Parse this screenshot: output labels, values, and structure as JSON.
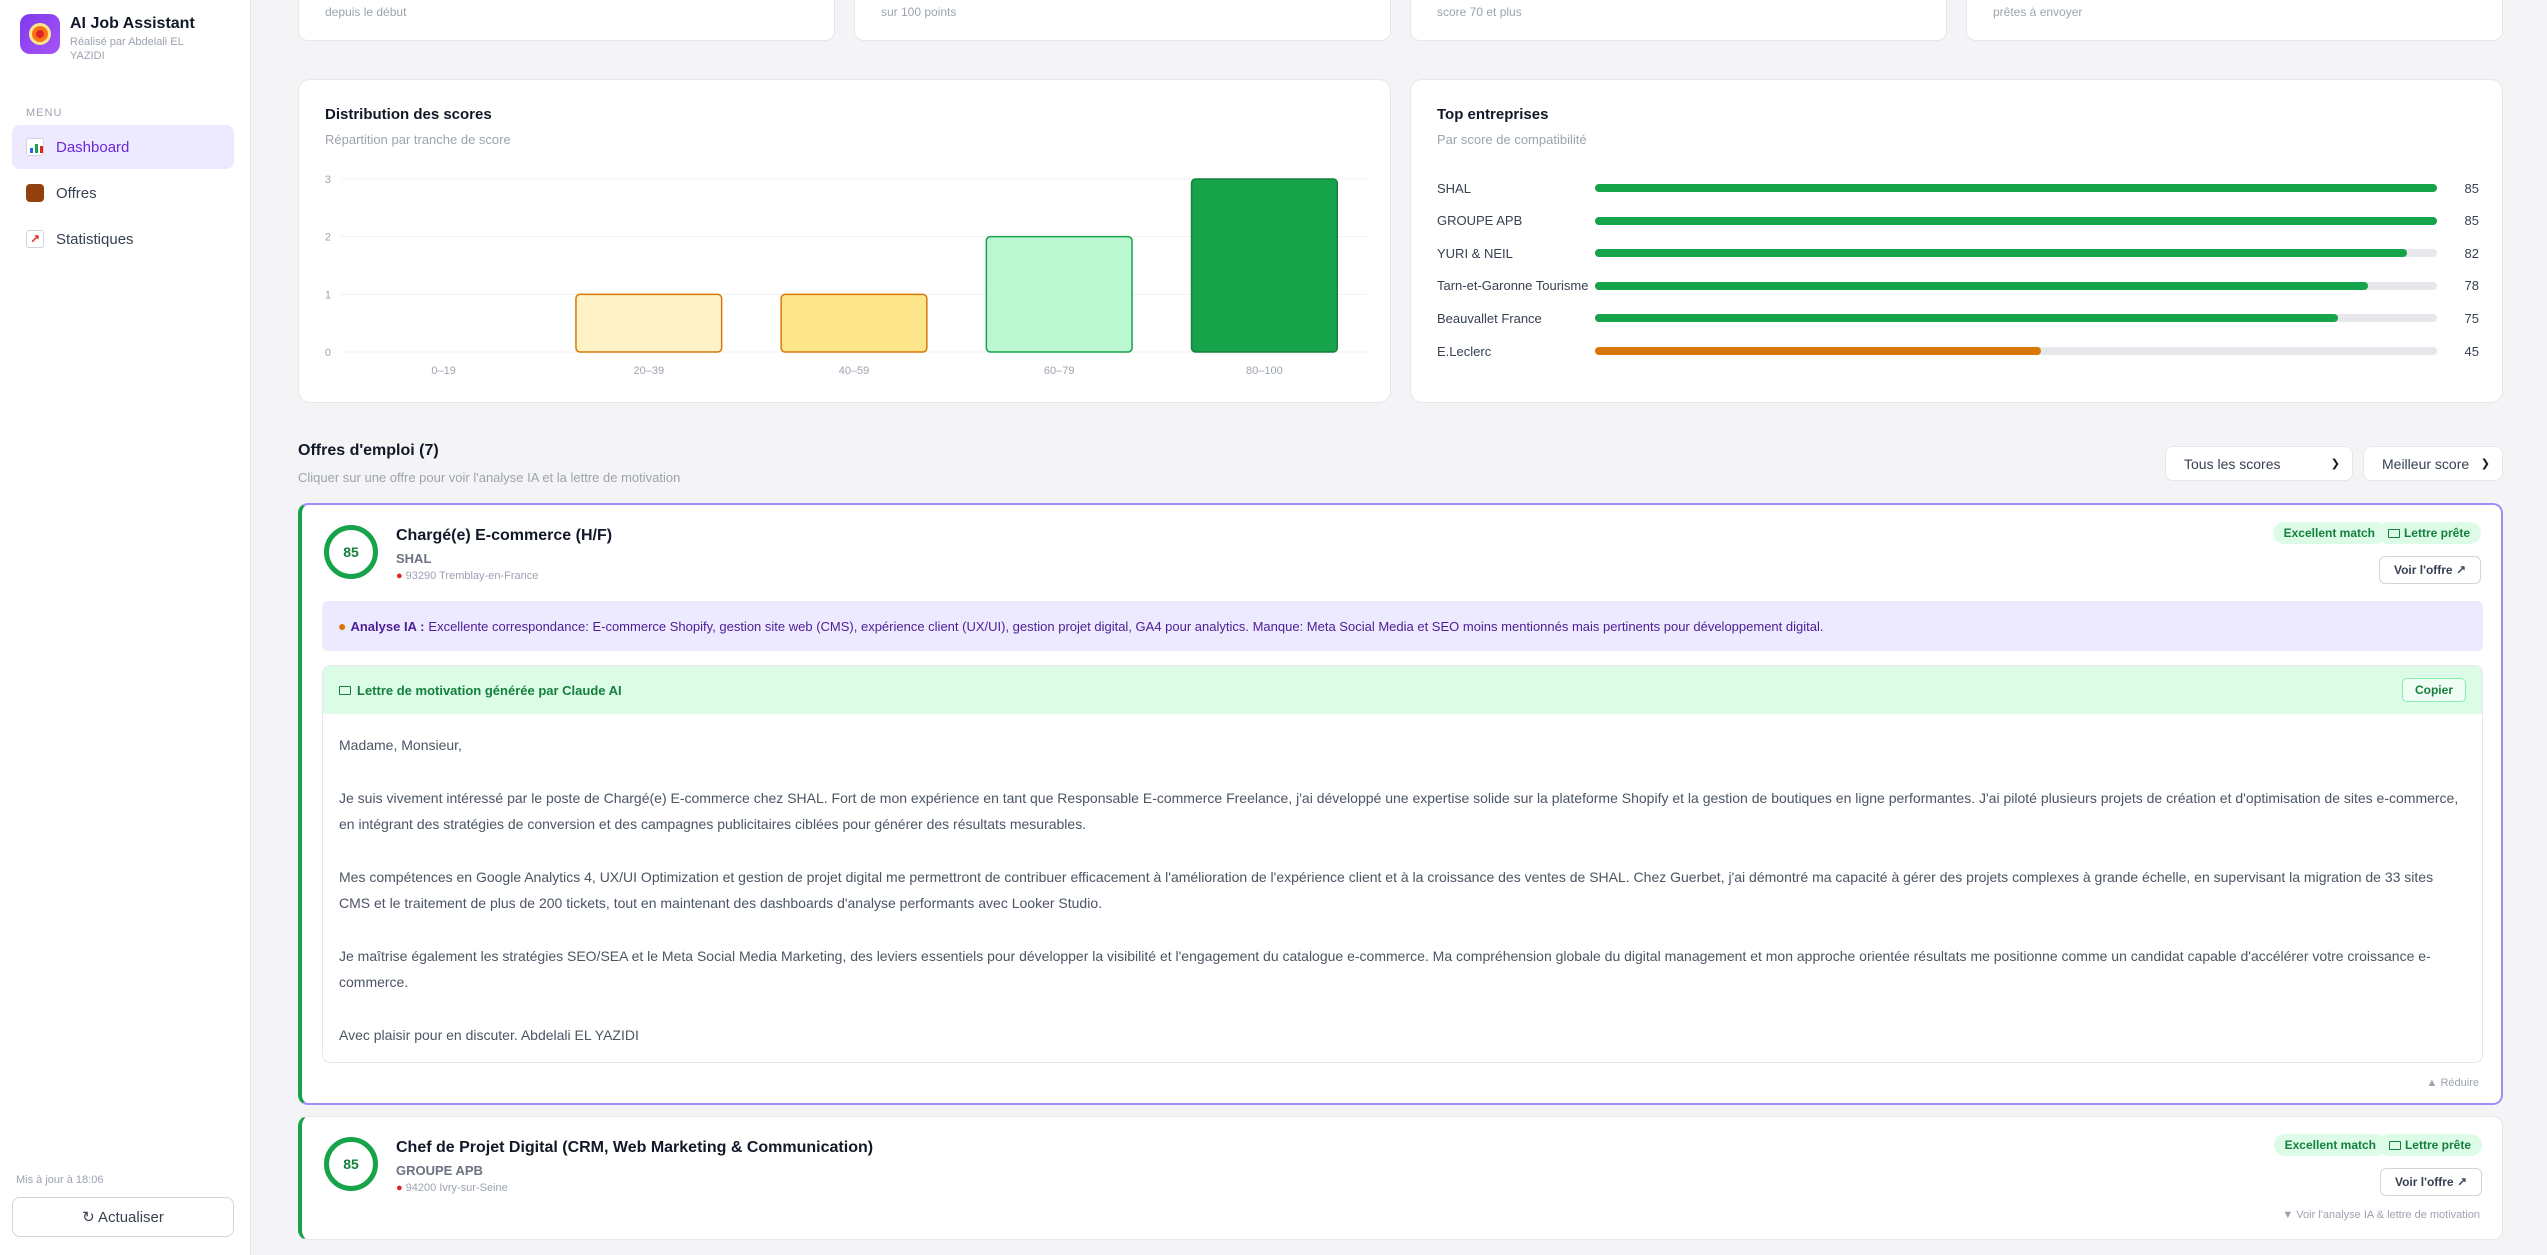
{
  "app": {
    "title": "AI Job Assistant",
    "subtitle": "Réalisé par Abdelali EL YAZIDI"
  },
  "sidebar": {
    "menu_label": "MENU",
    "items": [
      {
        "label": "Dashboard",
        "icon": "bar-chart-icon",
        "active": true
      },
      {
        "label": "Offres",
        "icon": "briefcase-icon",
        "active": false
      },
      {
        "label": "Statistiques",
        "icon": "trend-chart-icon",
        "active": false
      }
    ],
    "updated": "Mis à jour à 18:06",
    "refresh_label": "↻ Actualiser"
  },
  "stats": [
    {
      "caption": "depuis le début"
    },
    {
      "caption": "sur 100 points"
    },
    {
      "caption": "score 70 et plus"
    },
    {
      "caption": "prêtes à envoyer"
    }
  ],
  "distribution": {
    "title": "Distribution des scores",
    "subtitle": "Répartition par tranche de score",
    "chart_data": {
      "type": "bar",
      "categories": [
        "0–19",
        "20–39",
        "40–59",
        "60–79",
        "80–100"
      ],
      "values": [
        0,
        1,
        1,
        2,
        3
      ],
      "ylim": [
        0,
        3
      ],
      "yticks": [
        "0",
        "1",
        "2",
        "3"
      ],
      "bar_fill": [
        "#fef3c7",
        "#fef3c7",
        "#fde68a",
        "#bbf7d0",
        "#16a34a"
      ],
      "bar_stroke": [
        "#d97706",
        "#d97706",
        "#d97706",
        "#16a34a",
        "#15803d"
      ],
      "grid": true
    }
  },
  "top_companies": {
    "title": "Top entreprises",
    "subtitle": "Par score de compatibilité",
    "chart_data": {
      "type": "bar",
      "orientation": "horizontal",
      "categories": [
        "SHAL",
        "GROUPE APB",
        "YURI & NEIL",
        "Tarn-et-Garonne Tourisme",
        "Beauvallet France",
        "E.Leclerc"
      ],
      "values": [
        85,
        85,
        82,
        78,
        75,
        45
      ],
      "xlim": [
        0,
        85
      ],
      "colors": [
        "#16a34a",
        "#16a34a",
        "#16a34a",
        "#16a34a",
        "#16a34a",
        "#d97706"
      ]
    }
  },
  "offers_section": {
    "title": "Offres d'emploi (7)",
    "subtitle": "Cliquer sur une offre pour voir l'analyse IA et la lettre de motivation",
    "filter_score": "Tous les scores",
    "sort": "Meilleur score"
  },
  "offers": [
    {
      "score": "85",
      "title": "Chargé(e) E-commerce (H/F)",
      "company": "SHAL",
      "location": "93290 Tremblay-en-France",
      "badge_match": "Excellent match",
      "badge_letter": "Lettre prête",
      "view_label": "Voir l'offre ↗",
      "analysis_label": "Analyse IA :",
      "analysis_text": "Excellente correspondance: E-commerce Shopify, gestion site web (CMS), expérience client (UX/UI), gestion projet digital, GA4 pour analytics. Manque: Meta Social Media et SEO moins mentionnés mais pertinents pour développement digital.",
      "letter_title": "Lettre de motivation générée par Claude AI",
      "copy_label": "Copier",
      "letter": [
        "Madame, Monsieur,",
        "Je suis vivement intéressé par le poste de Chargé(e) E-commerce chez SHAL. Fort de mon expérience en tant que Responsable E-commerce Freelance, j'ai développé une expertise solide sur la plateforme Shopify et la gestion de boutiques en ligne performantes. J'ai piloté plusieurs projets de création et d'optimisation de sites e-commerce, en intégrant des stratégies de conversion et des campagnes publicitaires ciblées pour générer des résultats mesurables.",
        "Mes compétences en Google Analytics 4, UX/UI Optimization et gestion de projet digital me permettront de contribuer efficacement à l'amélioration de l'expérience client et à la croissance des ventes de SHAL. Chez Guerbet, j'ai démontré ma capacité à gérer des projets complexes à grande échelle, en supervisant la migration de 33 sites CMS et le traitement de plus de 200 tickets, tout en maintenant des dashboards d'analyse performants avec Looker Studio.",
        "Je maîtrise également les stratégies SEO/SEA et le Meta Social Media Marketing, des leviers essentiels pour développer la visibilité et l'engagement du catalogue e-commerce. Ma compréhension globale du digital management et mon approche orientée résultats me positionne comme un candidat capable d'accélérer votre croissance e-commerce.",
        "Avec plaisir pour en discuter. Abdelali EL YAZIDI"
      ],
      "toggle_label": "▲ Réduire"
    },
    {
      "score": "85",
      "title": "Chef de Projet Digital (CRM, Web Marketing & Communication)",
      "company": "GROUPE APB",
      "location": "94200 Ivry-sur-Seine",
      "badge_match": "Excellent match",
      "badge_letter": "Lettre prête",
      "view_label": "Voir l'offre ↗",
      "toggle_label": "▼ Voir l'analyse IA & lettre de motivation"
    }
  ]
}
